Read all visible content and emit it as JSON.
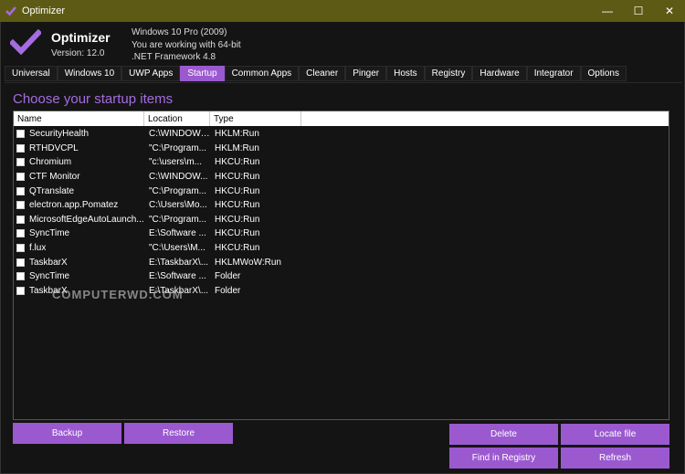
{
  "window": {
    "title": "Optimizer",
    "minimize": "—",
    "maximize": "☐",
    "close": "✕"
  },
  "app": {
    "name": "Optimizer",
    "version": "Version: 12.0",
    "sysinfo": [
      "Windows 10 Pro (2009)",
      "You are working with 64-bit",
      ".NET Framework 4.8"
    ],
    "accent": "#9b59d0"
  },
  "tabs": [
    {
      "label": "Universal",
      "active": false
    },
    {
      "label": "Windows 10",
      "active": false
    },
    {
      "label": "UWP Apps",
      "active": false
    },
    {
      "label": "Startup",
      "active": true
    },
    {
      "label": "Common Apps",
      "active": false
    },
    {
      "label": "Cleaner",
      "active": false
    },
    {
      "label": "Pinger",
      "active": false
    },
    {
      "label": "Hosts",
      "active": false
    },
    {
      "label": "Registry",
      "active": false
    },
    {
      "label": "Hardware",
      "active": false
    },
    {
      "label": "Integrator",
      "active": false
    },
    {
      "label": "Options",
      "active": false
    }
  ],
  "startup": {
    "title": "Choose your startup items",
    "columns": [
      "Name",
      "Location",
      "Type"
    ],
    "items": [
      {
        "name": "SecurityHealth",
        "location": "C:\\WINDOWS\\...",
        "type": "HKLM:Run"
      },
      {
        "name": "RTHDVCPL",
        "location": "\"C:\\Program...",
        "type": "HKLM:Run"
      },
      {
        "name": "Chromium",
        "location": "\"c:\\users\\m...",
        "type": "HKCU:Run"
      },
      {
        "name": "CTF Monitor",
        "location": "C:\\WINDOW...",
        "type": "HKCU:Run"
      },
      {
        "name": "QTranslate",
        "location": "\"C:\\Program...",
        "type": "HKCU:Run"
      },
      {
        "name": "electron.app.Pomatez",
        "location": "C:\\Users\\Mo...",
        "type": "HKCU:Run"
      },
      {
        "name": "MicrosoftEdgeAutoLaunch...",
        "location": "\"C:\\Program...",
        "type": "HKCU:Run"
      },
      {
        "name": "SyncTime",
        "location": "E:\\Software ...",
        "type": "HKCU:Run"
      },
      {
        "name": "f.lux",
        "location": "\"C:\\Users\\M...",
        "type": "HKCU:Run"
      },
      {
        "name": "TaskbarX",
        "location": "E:\\TaskbarX\\...",
        "type": "HKLMWoW:Run"
      },
      {
        "name": "SyncTime",
        "location": "E:\\Software ...",
        "type": "Folder"
      },
      {
        "name": "TaskbarX",
        "location": "E:\\TaskbarX\\...",
        "type": "Folder"
      }
    ],
    "buttons": {
      "backup": "Backup",
      "restore": "Restore",
      "delete": "Delete",
      "locate": "Locate file",
      "find_registry": "Find in Registry",
      "refresh": "Refresh"
    }
  },
  "watermark": "COMPUTERWD.COM"
}
